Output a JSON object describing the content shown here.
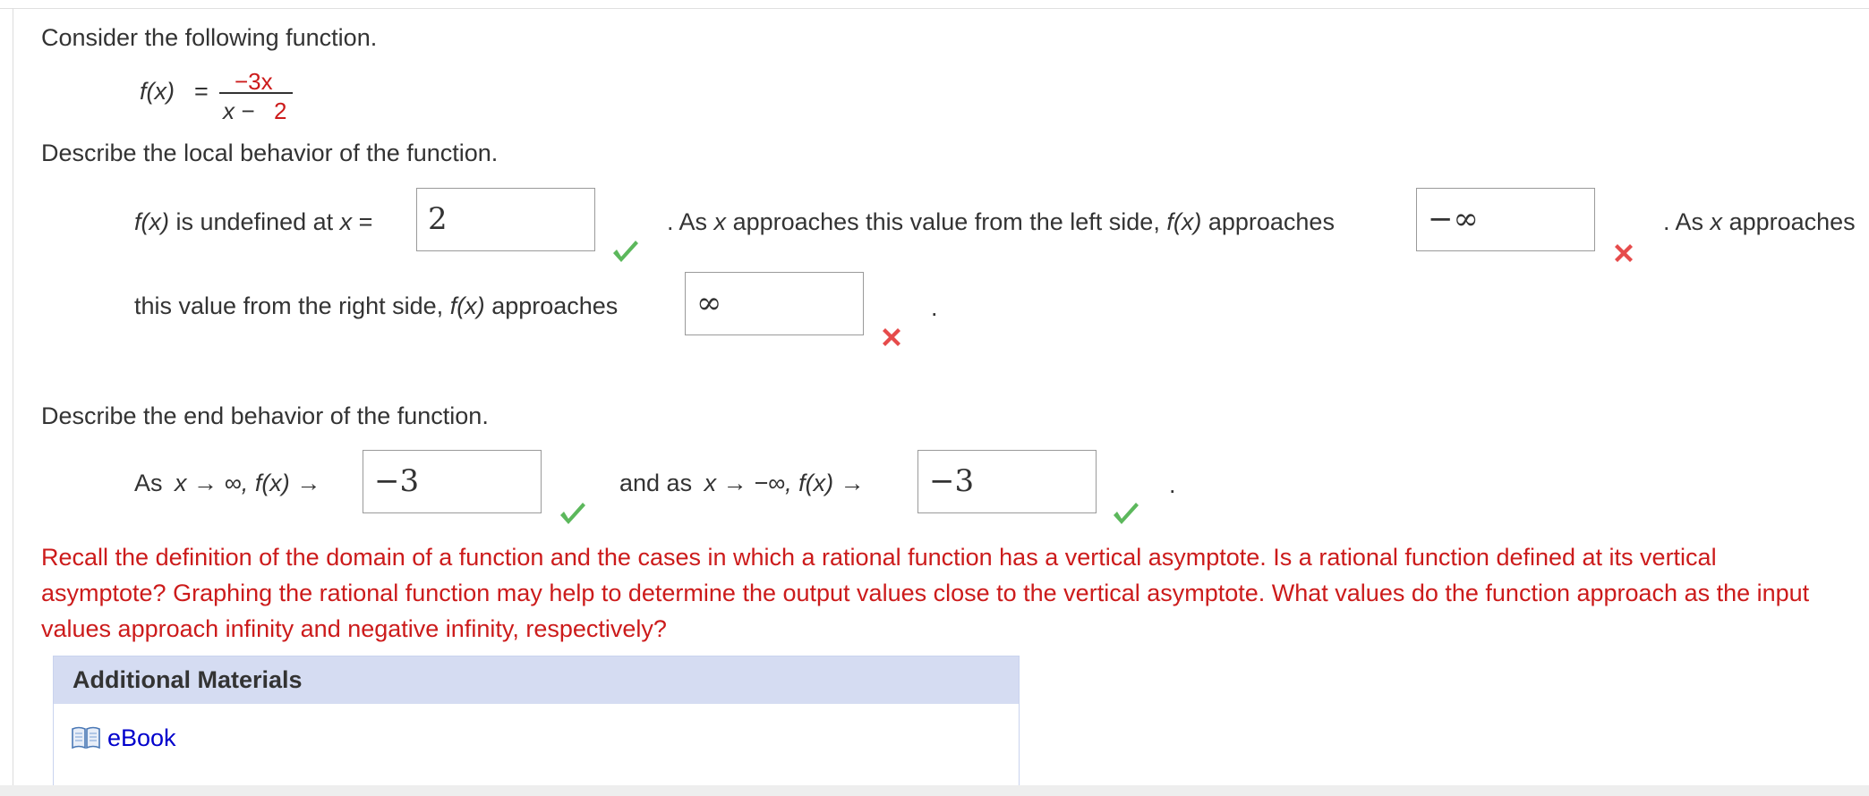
{
  "question": {
    "intro": "Consider the following function.",
    "function": {
      "name": "f(x)",
      "equals": "=",
      "numerator": "−3x",
      "denominator_var": "x −",
      "denominator_const": "2"
    },
    "local": {
      "prompt": "Describe the local behavior of the function.",
      "undefined_label_fx": "f(x)",
      "undefined_label_mid": "is undefined at",
      "undefined_label_x": "x",
      "undefined_label_eq": "=",
      "undefined_answer": "2",
      "undefined_status": "correct",
      "left_part1": ". As",
      "left_x": "x",
      "left_part2": "approaches this value from the left side,",
      "left_fx": "f(x)",
      "left_part3": "approaches",
      "left_answer": "−∞",
      "left_status": "incorrect",
      "right_lead1": ". As",
      "right_lead_x": "x",
      "right_lead2": "approaches",
      "right_part1": "this value from the right side,",
      "right_fx": "f(x)",
      "right_part2": "approaches",
      "right_answer": "∞",
      "right_status": "incorrect",
      "period": "."
    },
    "end": {
      "prompt": "Describe the end behavior of the function.",
      "as_label": "As",
      "pos_expr": "x → ∞,",
      "pos_fx": "f(x)",
      "arrow": "→",
      "pos_answer": "−3",
      "pos_status": "correct",
      "and_as_label": "and as",
      "neg_expr": "x → −∞,",
      "neg_fx": "f(x)",
      "neg_answer": "−3",
      "neg_status": "correct",
      "period": "."
    },
    "hint": "Recall the definition of the domain of a function and the cases in which a rational function has a vertical asymptote. Is a rational function defined at its vertical asymptote? Graphing the rational function may help to determine the output values close to the vertical asymptote. What values do the function approach as the input values approach infinity and negative infinity, respectively?"
  },
  "additional_materials": {
    "title": "Additional Materials",
    "ebook_icon": "book-icon",
    "ebook_label": "eBook"
  },
  "colors": {
    "hint_red": "#cc1b1b",
    "correct_green": "#5cb85c",
    "incorrect_red": "#e64b4b",
    "panel_header": "#d5dcf2",
    "link_blue": "#0000cc"
  }
}
